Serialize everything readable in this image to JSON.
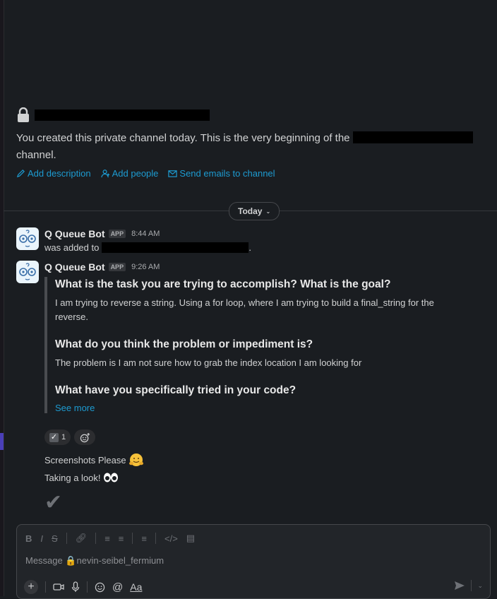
{
  "channel": {
    "intro_text": "You created this private channel today. This is the very beginning of the",
    "intro_suffix": "channel."
  },
  "actions": [
    {
      "label": "Add description",
      "icon": "pencil-icon"
    },
    {
      "label": "Add people",
      "icon": "person-add-icon"
    },
    {
      "label": "Send emails to channel",
      "icon": "mail-icon"
    }
  ],
  "date_divider": {
    "label": "Today"
  },
  "messages": [
    {
      "sender": "Q Queue Bot",
      "badge": "APP",
      "time": "8:44 AM",
      "text": "was added to"
    },
    {
      "sender": "Q Queue Bot",
      "badge": "APP",
      "time": "9:26 AM",
      "qa": [
        {
          "q": "What is the task you are trying to accomplish? What is the goal?",
          "a": "I am trying to reverse a string. Using a for loop, where I am trying to build a final_string for the reverse."
        },
        {
          "q": "What do you think the problem or impediment is?",
          "a": "The problem is I am not sure how to grab the index location I am looking for"
        },
        {
          "q": "What have you specifically tried in your code?"
        }
      ],
      "see_more": "See more",
      "reaction_count": "1"
    }
  ],
  "followups": [
    {
      "text": "Screenshots Please"
    },
    {
      "text": "Taking a look!"
    }
  ],
  "composer": {
    "placeholder": "Message 🔒nevin-seibel_fermium",
    "format_label": "Aa"
  },
  "colors": {
    "link": "#1d9bd1",
    "background": "#1a1d21",
    "accent": "#4a3fb8"
  }
}
